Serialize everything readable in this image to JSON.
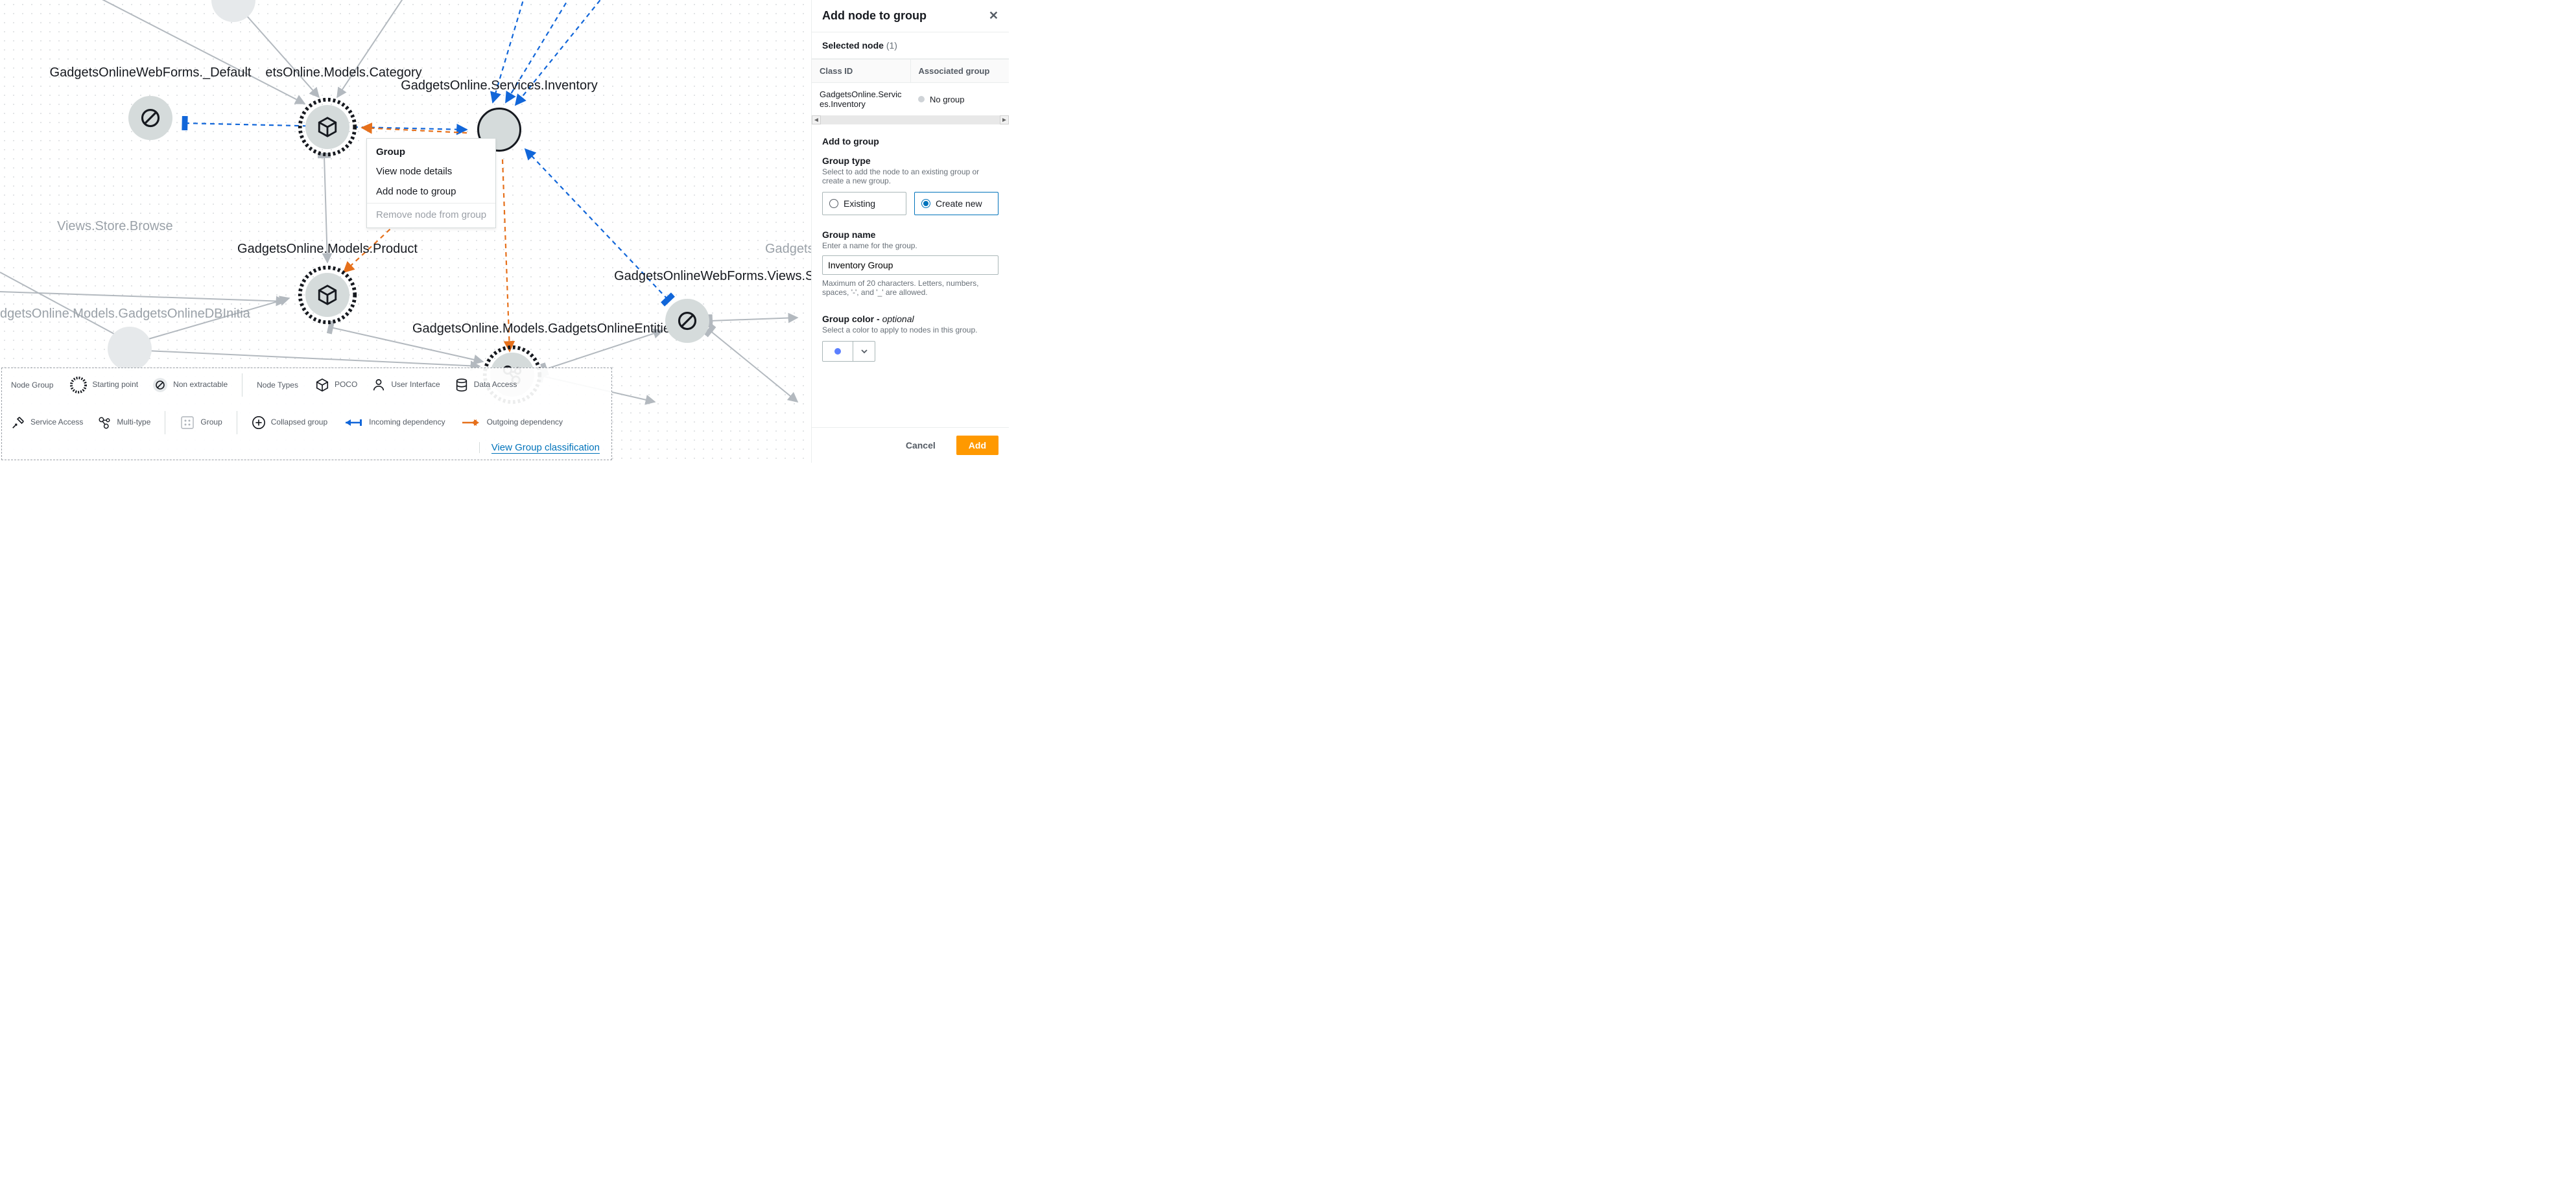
{
  "canvas": {
    "labels": {
      "default": "GadgetsOnlineWebForms._Default",
      "category": "etsOnline.Models.Category",
      "inventory": "GadgetsOnline.Services.Inventory",
      "storeBrowse": "Views.Store.Browse",
      "product": "GadgetsOnline.Models.Product",
      "shoppingCart": "GadgetsOnlineWebForms.Views.ShoppingCa",
      "dbInit": "dgetsOnline.Models.GadgetsOnlineDBInitia",
      "entities": "GadgetsOnline.Models.GadgetsOnlineEntities",
      "rightFaded": "GadgetsOnline"
    }
  },
  "contextMenu": {
    "header": "Group",
    "viewDetails": "View node details",
    "addToGroup": "Add node to group",
    "removeFromGroup": "Remove node from group"
  },
  "legend": {
    "nodeGroupLabel": "Node Group",
    "startingPoint": "Starting point",
    "nonExtractable": "Non extractable",
    "nodeTypesLabel": "Node Types",
    "poco": "POCO",
    "ui": "User Interface",
    "dataAccess": "Data Access",
    "serviceAccess": "Service Access",
    "multiType": "Multi-type",
    "group": "Group",
    "collapsedGroup": "Collapsed group",
    "incoming": "Incoming dependency",
    "outgoing": "Outgoing dependency",
    "link": "View Group classification"
  },
  "panel": {
    "title": "Add node to group",
    "selectedNodeHeader": "Selected node",
    "selectedCount": "(1)",
    "colClassId": "Class ID",
    "colAssocGroup": "Associated group",
    "row": {
      "classId": "GadgetsOnline.Services.Inventory",
      "assoc": "No group"
    },
    "addHeader": "Add to group",
    "groupTypeLabel": "Group type",
    "groupTypeHint": "Select to add the node to an existing group or create a new group.",
    "radioExisting": "Existing",
    "radioCreateNew": "Create new",
    "groupNameLabel": "Group name",
    "groupNameHint": "Enter a name for the group.",
    "groupNameValue": "Inventory Group",
    "groupNameConstraint": "Maximum of 20 characters. Letters, numbers, spaces, '-', and '_' are allowed.",
    "groupColorLabel": "Group color - ",
    "groupColorOptional": "optional",
    "groupColorHint": "Select a color to apply to nodes in this group.",
    "cancel": "Cancel",
    "add": "Add"
  }
}
